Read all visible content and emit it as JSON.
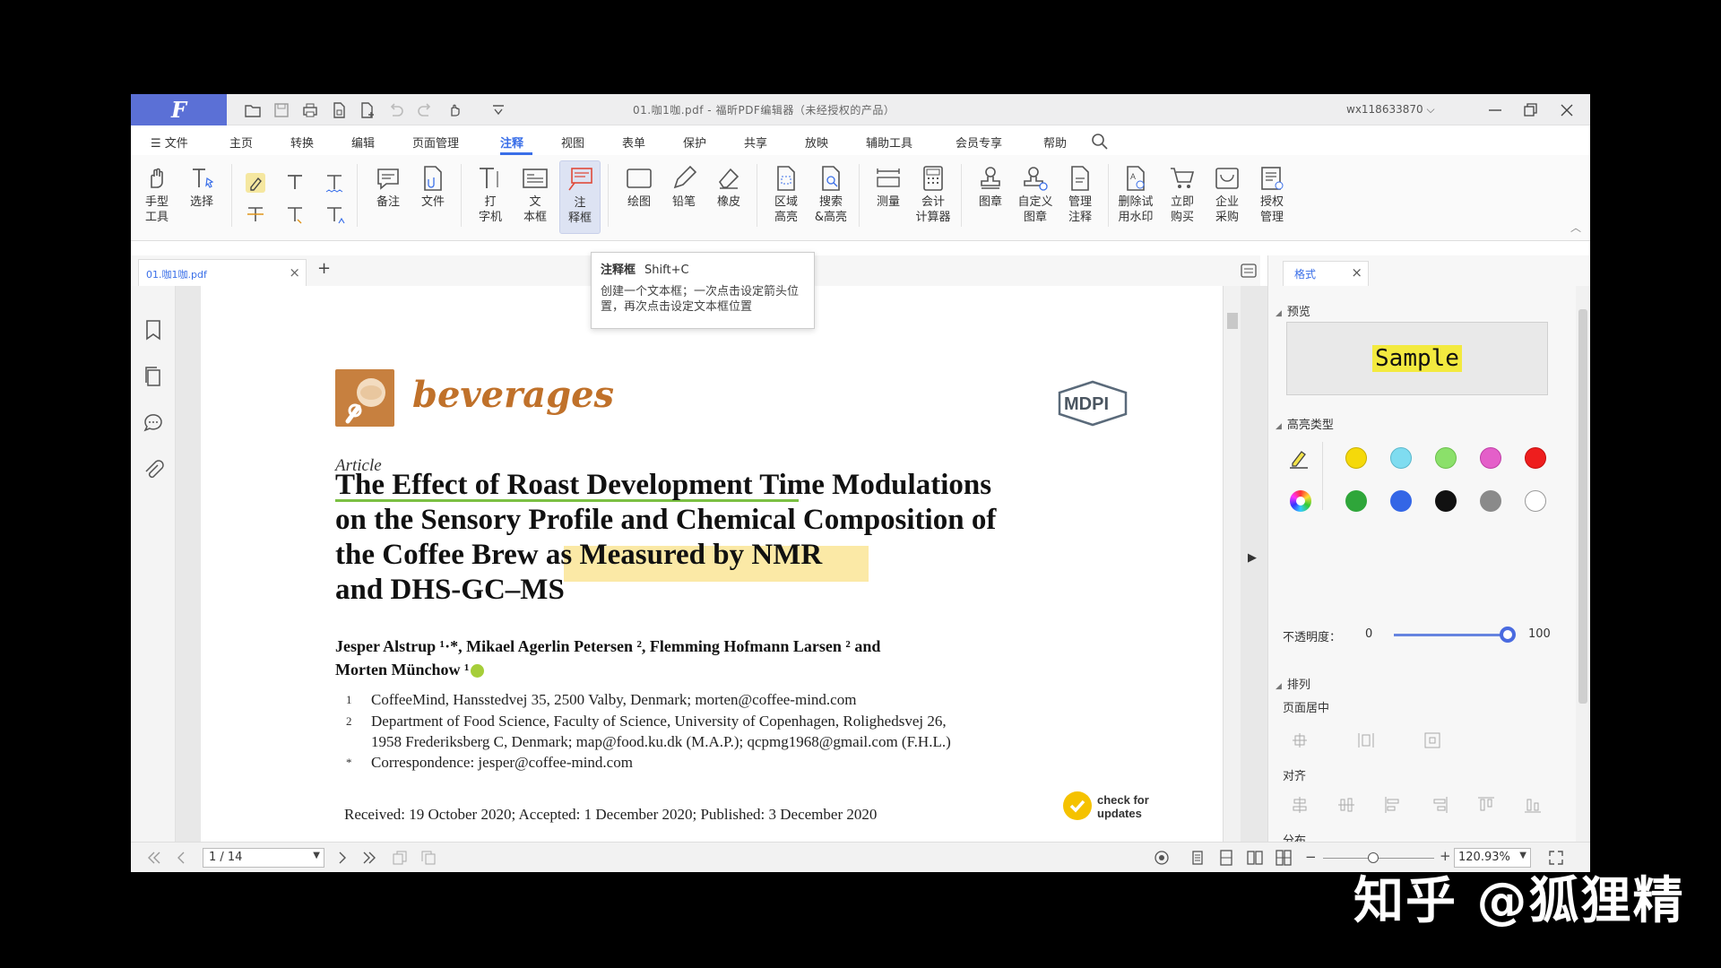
{
  "app": {
    "logo": "F",
    "doc_title": "01.咖1咖.pdf - 福昕PDF编辑器（未经授权的产品）",
    "user": "wx118633870"
  },
  "menu": [
    "文件",
    "主页",
    "转换",
    "编辑",
    "页面管理",
    "注释",
    "视图",
    "表单",
    "保护",
    "共享",
    "放映",
    "辅助工具",
    "会员专享",
    "帮助"
  ],
  "menu_active": "注释",
  "ribbon": {
    "tools": [
      {
        "label": "手型\n工具",
        "icon": "hand-icon"
      },
      {
        "label": "选择",
        "icon": "select-text-icon"
      },
      {
        "label": "备注",
        "icon": "note-icon"
      },
      {
        "label": "文件",
        "icon": "file-attach-icon"
      },
      {
        "label": "打\n字机",
        "icon": "typewriter-icon"
      },
      {
        "label": "文\n本框",
        "icon": "textbox-icon"
      },
      {
        "label": "注\n释框",
        "icon": "callout-icon"
      },
      {
        "label": "绘图",
        "icon": "rectangle-icon"
      },
      {
        "label": "铅笔",
        "icon": "pencil-icon"
      },
      {
        "label": "橡皮",
        "icon": "eraser-icon"
      },
      {
        "label": "区域\n高亮",
        "icon": "area-highlight-icon"
      },
      {
        "label": "搜索\n&高亮",
        "icon": "search-highlight-icon"
      },
      {
        "label": "测量",
        "icon": "measure-icon"
      },
      {
        "label": "会计\n计算器",
        "icon": "calculator-icon"
      },
      {
        "label": "图章",
        "icon": "stamp-icon"
      },
      {
        "label": "自定义\n图章",
        "icon": "custom-stamp-icon"
      },
      {
        "label": "管理\n注释",
        "icon": "manage-comments-icon"
      },
      {
        "label": "删除试\n用水印",
        "icon": "remove-watermark-icon"
      },
      {
        "label": "立即\n购买",
        "icon": "cart-icon"
      },
      {
        "label": "企业\n采购",
        "icon": "enterprise-icon"
      },
      {
        "label": "授权\n管理",
        "icon": "license-icon"
      }
    ]
  },
  "tab": {
    "label": "01.咖1咖.pdf",
    "close": "×",
    "new": "+"
  },
  "tooltip": {
    "title": "注释框",
    "shortcut": "Shift+C",
    "body": "创建一个文本框；一次点击设定箭头位置，再次点击设定文本框位置"
  },
  "document": {
    "journal": "beverages",
    "publisher": "MDPI",
    "article_label": "Article",
    "title_lines": [
      "The Effect of Roast Development Time Modulations",
      "on the Sensory Profile and Chemical Composition of",
      "the Coffee Brew as Measured by NMR",
      "and DHS-GC–MS"
    ],
    "authors_line1": "Jesper Alstrup ¹·*, Mikael Agerlin Petersen ², Flemming Hofmann Larsen ² and",
    "authors_line2": "Morten Münchow ¹",
    "affiliations": [
      {
        "num": "1",
        "text": "CoffeeMind, Hansstedvej 35, 2500 Valby, Denmark; morten@coffee-mind.com"
      },
      {
        "num": "2",
        "text": "Department of Food Science, Faculty of Science, University of Copenhagen, Rolighedsvej 26,"
      },
      {
        "num": "",
        "text": "1958 Frederiksberg C, Denmark; map@food.ku.dk (M.A.P.); qcpmg1968@gmail.com (F.H.L.)"
      },
      {
        "num": "*",
        "text": "Correspondence: jesper@coffee-mind.com"
      }
    ],
    "received": "Received: 19 October 2020; Accepted: 1 December 2020; Published: 3 December 2020",
    "check_updates_1": "check for",
    "check_updates_2": "updates"
  },
  "right_panel": {
    "tab": "格式",
    "preview_section": "预览",
    "preview_text": "Sample",
    "highlight_section": "高亮类型",
    "colors_row1": [
      "#f5d90a",
      "#7fdcf0",
      "#8be06a",
      "#e45fc9",
      "#ee1e1e"
    ],
    "colors_row2": [
      "#2fa63a",
      "#3366e6",
      "#111111",
      "#8a8a8a",
      "#ffffff"
    ],
    "opacity_label": "不透明度：",
    "opacity_min": "0",
    "opacity_max": "100",
    "opacity_value": 100,
    "arrange_section": "排列",
    "page_center": "页面居中",
    "align": "对齐",
    "distribute": "分布"
  },
  "status": {
    "page": "1 / 14",
    "zoom": "120.93%",
    "zoom_fraction": 0.45
  },
  "watermark": "知乎 @狐狸精"
}
